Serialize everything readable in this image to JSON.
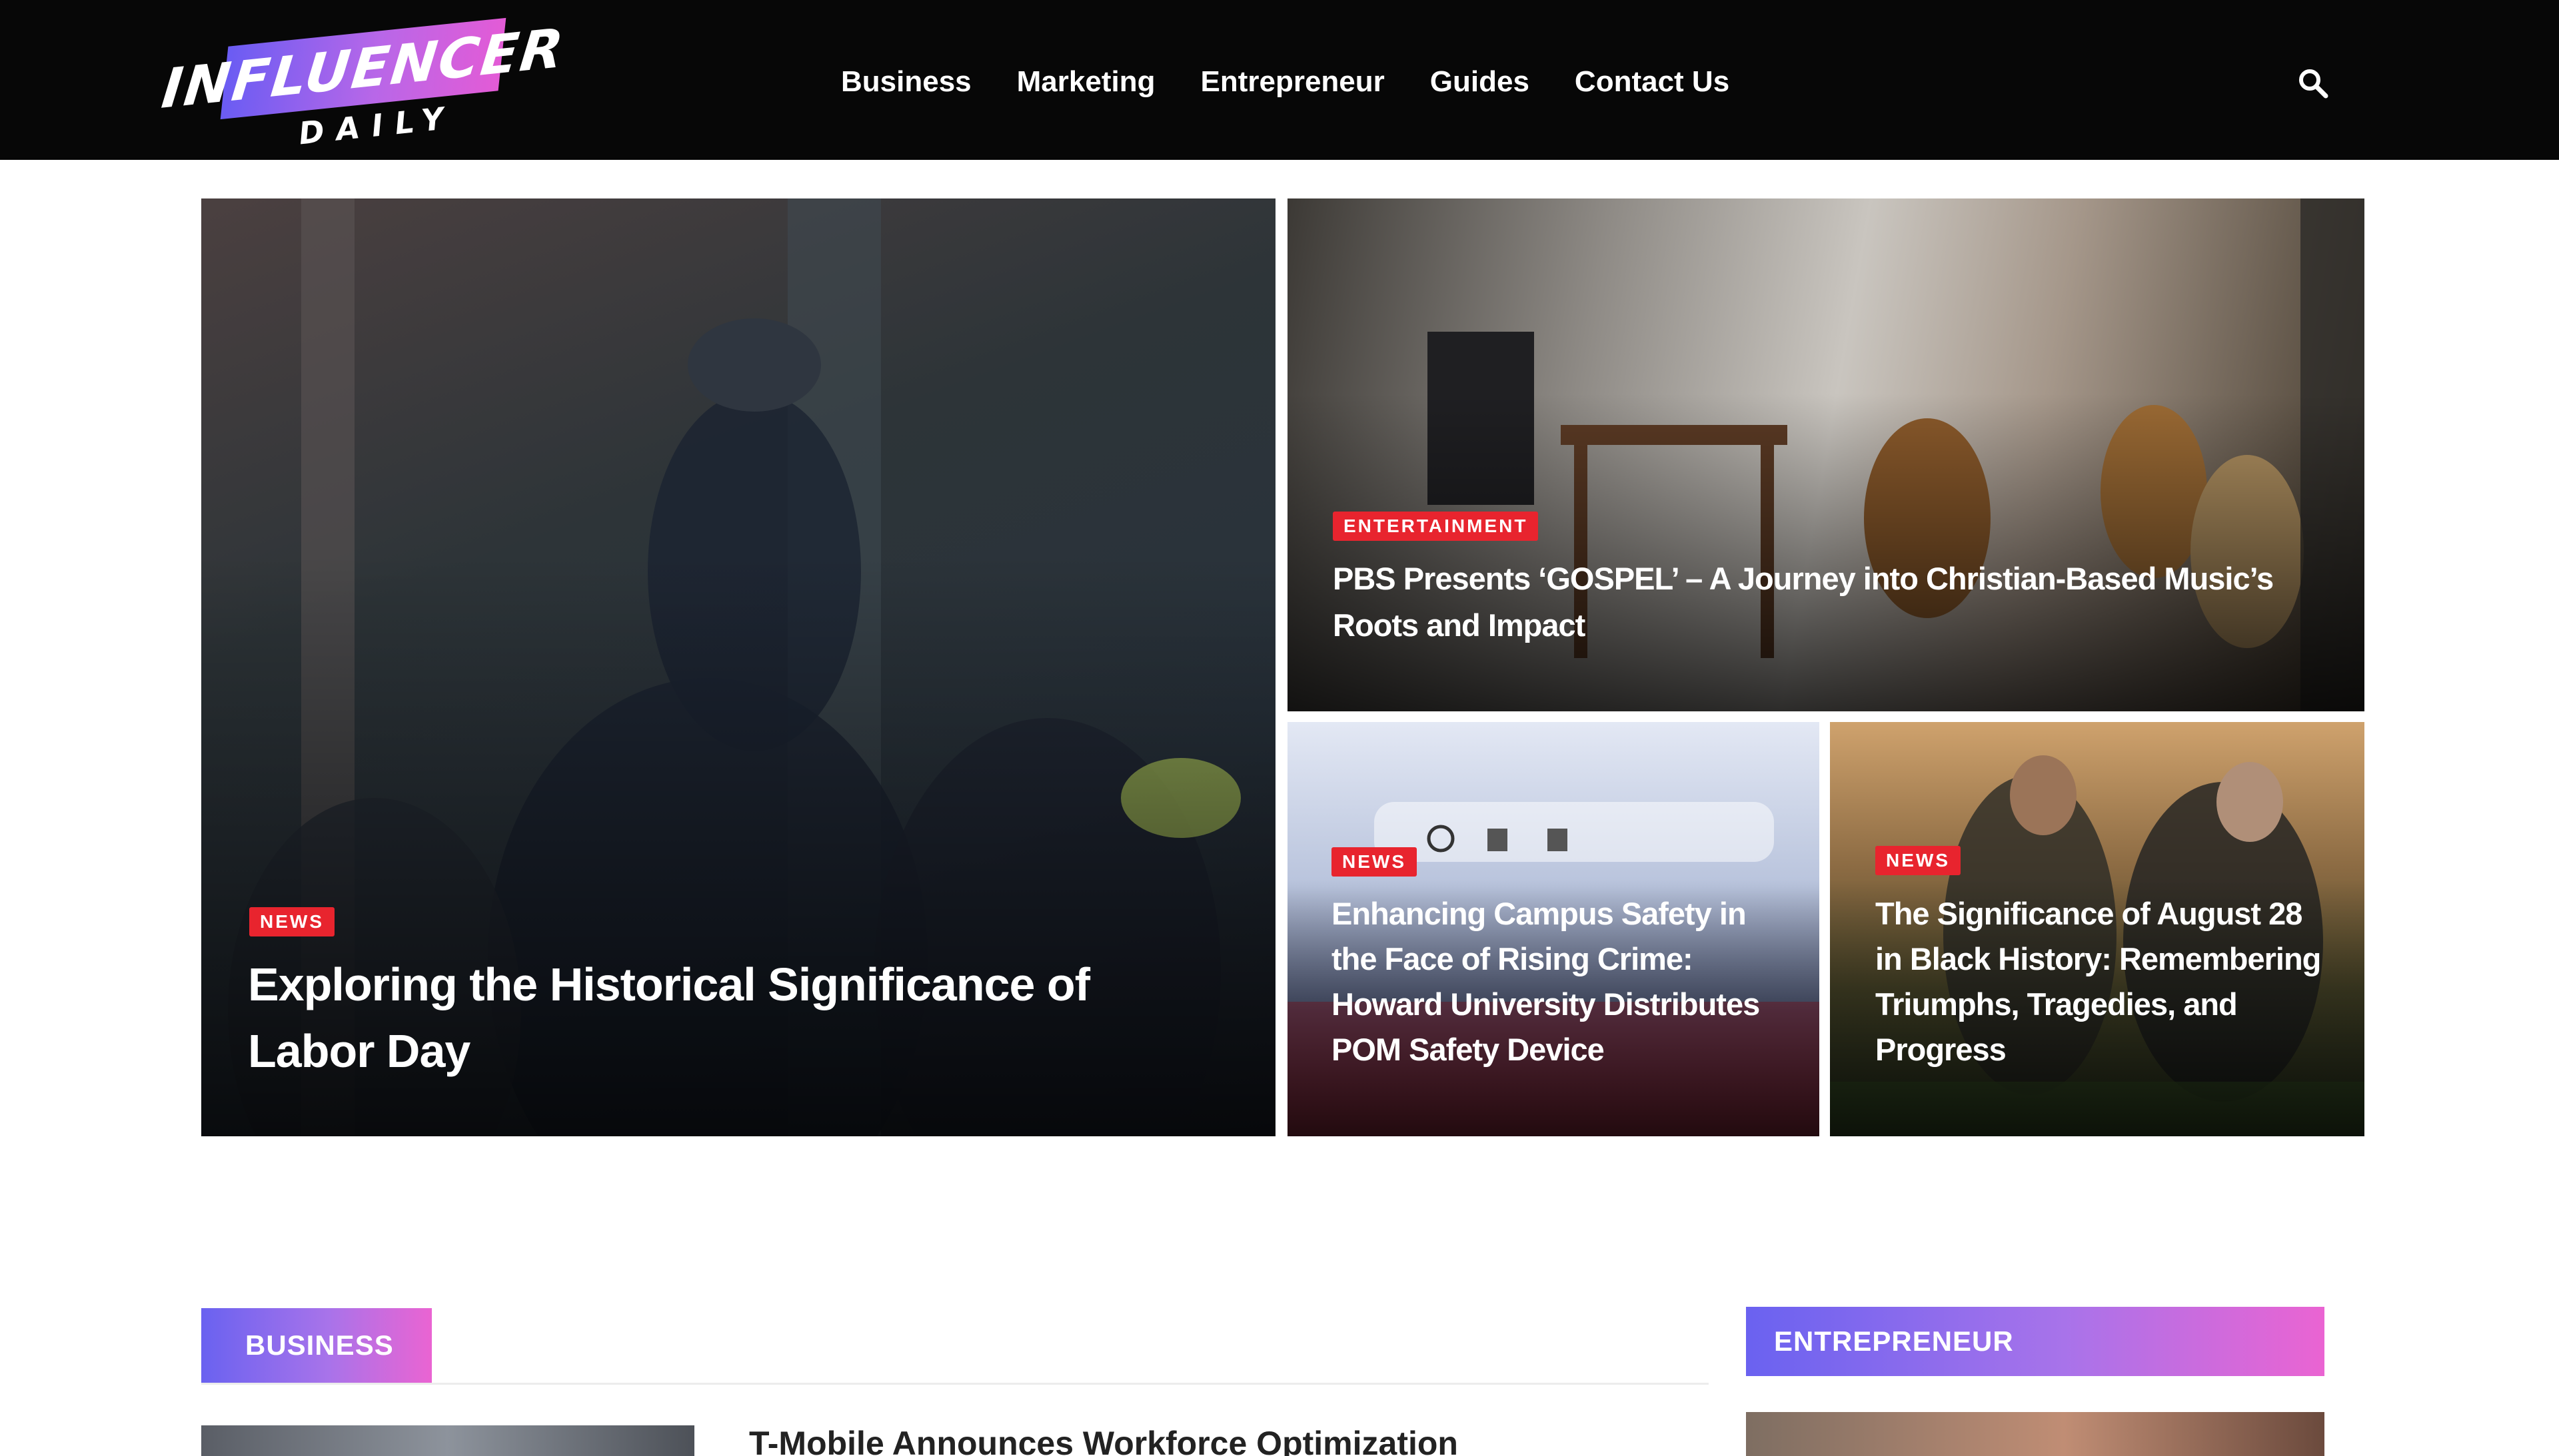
{
  "header": {
    "logo_top": "INFLUENCER",
    "logo_bottom": "DAILY",
    "nav": [
      "Business",
      "Marketing",
      "Entrepreneur",
      "Guides",
      "Contact Us"
    ],
    "search_icon": "search-icon"
  },
  "hero": {
    "main": {
      "category": "NEWS",
      "title": "Exploring the Historical Significance of Labor Day"
    },
    "top_right": {
      "category": "ENTERTAINMENT",
      "title": "PBS Presents ‘GOSPEL’ – A Journey into Christian-Based Music’s Roots and Impact"
    },
    "bottom_left": {
      "category": "NEWS",
      "title": "Enhancing Campus Safety in the Face of Rising Crime: Howard University Distributes POM Safety Device"
    },
    "bottom_right": {
      "category": "NEWS",
      "title": "The Significance of August 28 in Black History: Remembering Triumphs, Tragedies, and Progress"
    }
  },
  "sections": {
    "business": {
      "label": "BUSINESS",
      "post_title": "T-Mobile Announces Workforce Optimization"
    },
    "entrepreneur": {
      "label": "ENTREPRENEUR"
    }
  },
  "colors": {
    "header_bg": "#070707",
    "badge": "#e8242e",
    "gradient_start": "#6a62f0",
    "gradient_end": "#ea64d2"
  }
}
